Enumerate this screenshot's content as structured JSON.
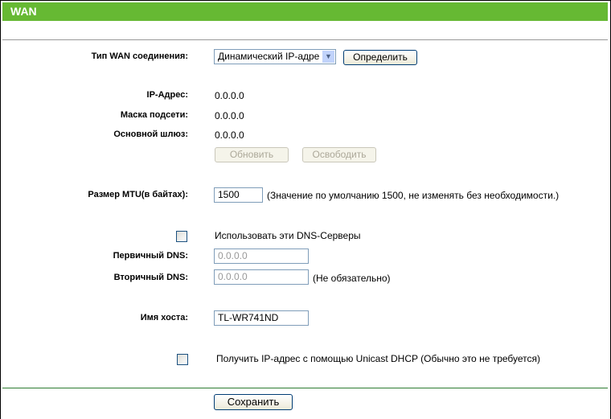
{
  "title": "WAN",
  "wan_type": {
    "label": "Тип WAN соединения:",
    "value": "Динамический IP-адре",
    "detect_button": "Определить"
  },
  "ip": {
    "label": "IP-Адрес:",
    "value": "0.0.0.0"
  },
  "mask": {
    "label": "Маска подсети:",
    "value": "0.0.0.0"
  },
  "gateway": {
    "label": "Основной шлюз:",
    "value": "0.0.0.0"
  },
  "renew_button": "Обновить",
  "release_button": "Освободить",
  "mtu": {
    "label": "Размер MTU(в байтах):",
    "value": "1500",
    "hint": "(Значение по умолчанию 1500, не изменять без необходимости.)"
  },
  "dns": {
    "checkbox_label": "Использовать эти DNS-Серверы",
    "checked": false,
    "primary_label": "Первичный DNS:",
    "primary_value": "0.0.0.0",
    "secondary_label": "Вторичный DNS:",
    "secondary_value": "0.0.0.0",
    "secondary_hint": "(Не обязательно)"
  },
  "host": {
    "label": "Имя хоста:",
    "value": "TL-WR741ND"
  },
  "unicast": {
    "label": "Получить IP-адрес с помощью Unicast DHCP (Обычно это не требуется)",
    "checked": false
  },
  "save_button": "Сохранить"
}
